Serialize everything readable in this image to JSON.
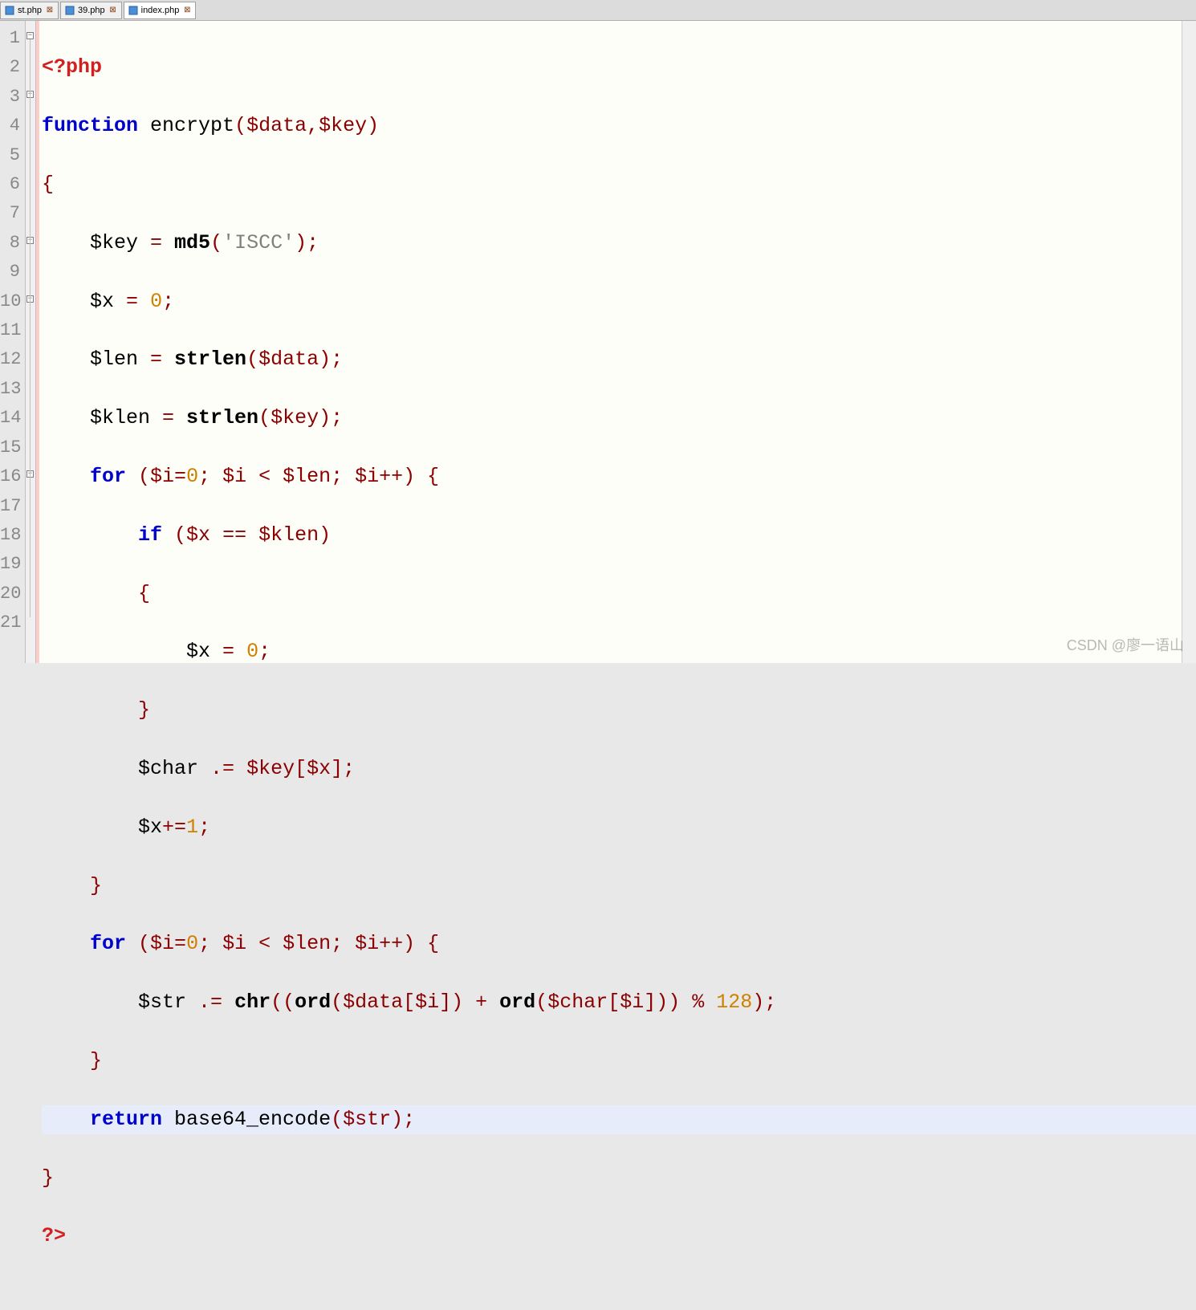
{
  "tabs": [
    {
      "label": "st.php",
      "active": false
    },
    {
      "label": "39.php",
      "active": false
    },
    {
      "label": "index.php",
      "active": true
    }
  ],
  "gutter": [
    "1",
    "2",
    "3",
    "4",
    "5",
    "6",
    "7",
    "8",
    "9",
    "10",
    "11",
    "12",
    "13",
    "14",
    "15",
    "16",
    "17",
    "18",
    "19",
    "20",
    "21"
  ],
  "code": {
    "l1_open": "<?php",
    "l2_kw": "function",
    "l2_name": " encrypt",
    "l2_args": "($data,$key)",
    "l3_brace": "{",
    "l4_pre": "    $key ",
    "l4_eq": "=",
    "l4_fn": " md5",
    "l4_p1": "(",
    "l4_str": "'ISCC'",
    "l4_p2": ");",
    "l5_pre": "    $x ",
    "l5_eq": "=",
    "l5_sp": " ",
    "l5_num": "0",
    "l5_end": ";",
    "l6_pre": "    $len ",
    "l6_eq": "=",
    "l6_fn": " strlen",
    "l6_p1": "($data);",
    "l7_pre": "    $klen ",
    "l7_eq": "=",
    "l7_fn": " strlen",
    "l7_p1": "($key);",
    "l8_kw": "for",
    "l8_a": " ($i",
    "l8_eq": "=",
    "l8_n": "0",
    "l8_b": "; $i ",
    "l8_lt": "<",
    "l8_c": " $len; $i",
    "l8_pp": "++",
    "l8_d": ") {",
    "l9_kw": "if",
    "l9_a": " ($x ",
    "l9_eq": "==",
    "l9_b": " $klen)",
    "l10_brace": "{",
    "l11_a": "$x ",
    "l11_eq": "=",
    "l11_sp": " ",
    "l11_n": "0",
    "l11_end": ";",
    "l12_brace": "}",
    "l13_a": "$char ",
    "l13_op": ".=",
    "l13_b": " $key[$x];",
    "l14_a": "$x",
    "l14_op": "+=",
    "l14_n": "1",
    "l14_end": ";",
    "l15_brace": "}",
    "l16_kw": "for",
    "l16_a": " ($i",
    "l16_eq": "=",
    "l16_n": "0",
    "l16_b": "; $i ",
    "l16_lt": "<",
    "l16_c": " $len; $i",
    "l16_pp": "++",
    "l16_d": ") {",
    "l17_a": "$str ",
    "l17_op": ".=",
    "l17_fn": " chr",
    "l17_p1": "((",
    "l17_fn2": "ord",
    "l17_b": "($data[$i]) ",
    "l17_plus": "+",
    "l17_sp": " ",
    "l17_fn3": "ord",
    "l17_c": "($char[$i])) ",
    "l17_mod": "%",
    "l17_sp2": " ",
    "l17_n": "128",
    "l17_end": ");",
    "l18_brace": "}",
    "l19_kw": "return",
    "l19_fn": " base64_encode",
    "l19_a": "($str);",
    "l20_brace": "}",
    "l21_close": "?>"
  },
  "fold": {
    "positions": [
      1,
      3,
      8,
      10,
      16
    ]
  },
  "watermark": "CSDN @廖一语山"
}
